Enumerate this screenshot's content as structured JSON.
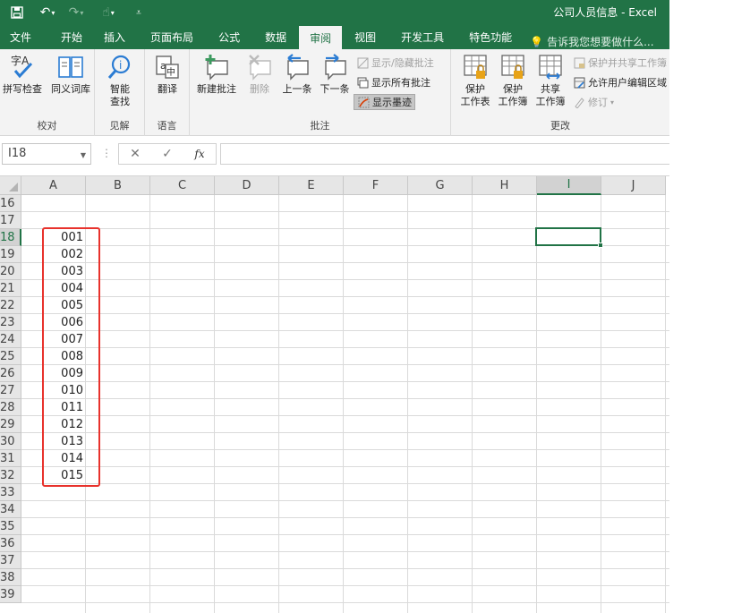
{
  "window": {
    "title": "公司人员信息 - Excel"
  },
  "qat": {
    "save": "save-icon",
    "undo": "undo-icon",
    "redo": "redo-icon",
    "touch": "touch-mode-icon",
    "customize": "customize-icon"
  },
  "tabs": [
    "文件",
    "开始",
    "插入",
    "页面布局",
    "公式",
    "数据",
    "审阅",
    "视图",
    "开发工具",
    "特色功能"
  ],
  "active_tab": "审阅",
  "tell_me": "告诉我您想要做什么...",
  "ribbon": {
    "proofing": {
      "label": "校对",
      "spelling": "拼写检查",
      "thesaurus": "同义词库"
    },
    "insights": {
      "label": "见解",
      "smart_lookup_l1": "智能",
      "smart_lookup_l2": "查找"
    },
    "language": {
      "label": "语言",
      "translate": "翻译"
    },
    "comments": {
      "label": "批注",
      "new_comment": "新建批注",
      "delete": "删除",
      "previous": "上一条",
      "next": "下一条",
      "show_hide": "显示/隐藏批注",
      "show_all": "显示所有批注",
      "show_ink": "显示墨迹"
    },
    "changes": {
      "label": "更改",
      "protect_sheet_l1": "保护",
      "protect_sheet_l2": "工作表",
      "protect_wb_l1": "保护",
      "protect_wb_l2": "工作簿",
      "share_wb_l1": "共享",
      "share_wb_l2": "工作簿",
      "protect_share": "保护并共享工作簿",
      "allow_edit": "允许用户编辑区域",
      "track_changes": "修订"
    }
  },
  "formula_bar": {
    "name_box": "I18",
    "formula": "",
    "fx_label": "fx"
  },
  "grid": {
    "columns": [
      "A",
      "B",
      "C",
      "D",
      "E",
      "F",
      "G",
      "H",
      "I",
      "J"
    ],
    "active_column": "I",
    "rows": [
      16,
      17,
      18,
      19,
      20,
      21,
      22,
      23,
      24,
      25,
      26,
      27,
      28,
      29,
      30,
      31,
      32,
      33,
      34,
      35,
      36,
      37,
      38,
      39
    ],
    "active_row": 18,
    "cells_A": [
      {
        "row": 18,
        "value": "001"
      },
      {
        "row": 19,
        "value": "002"
      },
      {
        "row": 20,
        "value": "003"
      },
      {
        "row": 21,
        "value": "004"
      },
      {
        "row": 22,
        "value": "005"
      },
      {
        "row": 23,
        "value": "006"
      },
      {
        "row": 24,
        "value": "007"
      },
      {
        "row": 25,
        "value": "008"
      },
      {
        "row": 26,
        "value": "009"
      },
      {
        "row": 27,
        "value": "010"
      },
      {
        "row": 28,
        "value": "011"
      },
      {
        "row": 29,
        "value": "012"
      },
      {
        "row": 30,
        "value": "013"
      },
      {
        "row": 31,
        "value": "014"
      },
      {
        "row": 32,
        "value": "015"
      }
    ]
  },
  "colors": {
    "accent": "#217346",
    "highlight": "#e8322c"
  }
}
